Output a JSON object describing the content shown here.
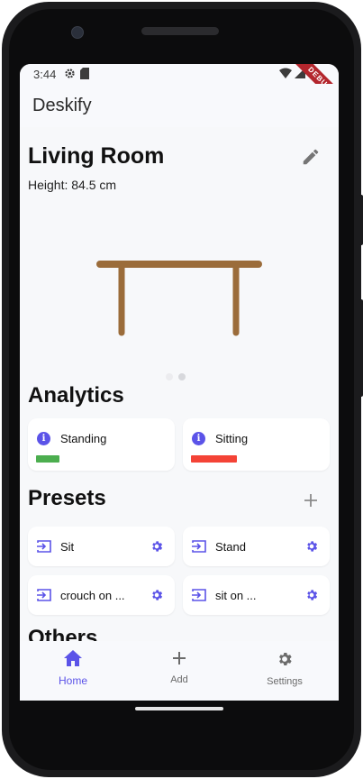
{
  "status_bar": {
    "time": "3:44",
    "debug_banner": "DEBUG"
  },
  "app_bar": {
    "title": "Deskify"
  },
  "room": {
    "title": "Living Room",
    "height_text": "Height: 84.5 cm"
  },
  "analytics": {
    "title": "Analytics",
    "cards": [
      {
        "label": "Standing",
        "bar_color": "#4cae4f",
        "bar_fraction": 0.18
      },
      {
        "label": "Sitting",
        "bar_color": "#f44336",
        "bar_fraction": 0.35
      }
    ]
  },
  "presets": {
    "title": "Presets",
    "items": [
      {
        "label": "Sit"
      },
      {
        "label": "Stand"
      },
      {
        "label": "crouch on ..."
      },
      {
        "label": "sit on ..."
      }
    ]
  },
  "others": {
    "title": "Others"
  },
  "bottom_nav": {
    "items": [
      {
        "label": "Home",
        "icon": "home-icon",
        "selected": true
      },
      {
        "label": "Add",
        "icon": "plus-icon",
        "selected": false
      },
      {
        "label": "Settings",
        "icon": "gear-icon",
        "selected": false
      }
    ]
  },
  "colors": {
    "accent": "#5b53e8",
    "desk": "#9b6c3a",
    "nav_inactive": "#6b6b6b"
  }
}
